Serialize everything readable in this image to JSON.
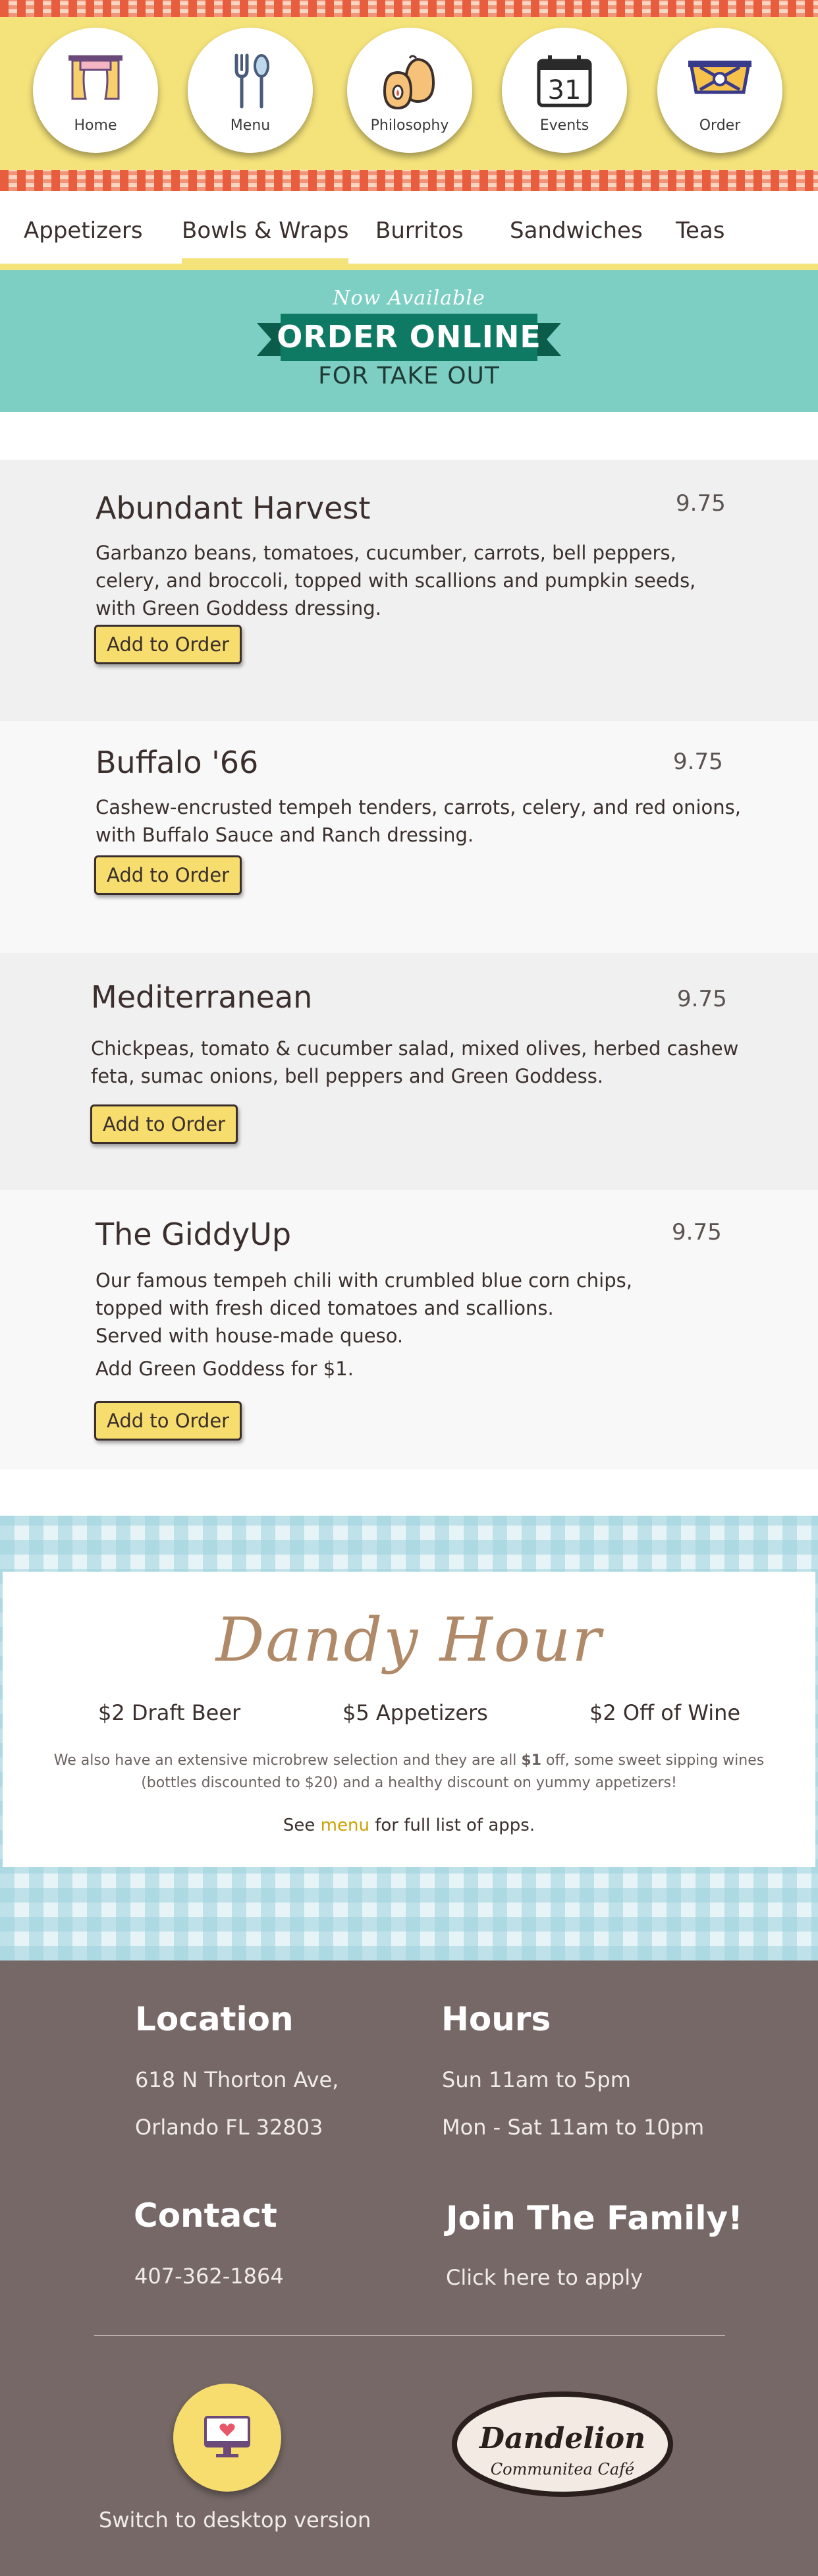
{
  "nav": {
    "items": [
      {
        "label": "Home",
        "icon": "curtains-icon"
      },
      {
        "label": "Menu",
        "icon": "utensils-icon"
      },
      {
        "label": "Philosophy",
        "icon": "fruit-icon"
      },
      {
        "label": "Events",
        "icon": "calendar-icon",
        "calendar_day": "31"
      },
      {
        "label": "Order",
        "icon": "takeout-box-icon"
      }
    ]
  },
  "tabs": {
    "items": [
      "Appetizers",
      "Bowls & Wraps",
      "Burritos",
      "Sandwiches",
      "Teas"
    ],
    "active": "Bowls & Wraps"
  },
  "banner": {
    "now_available": "Now Available",
    "order_online": "ORDER ONLINE",
    "for_take_out": "FOR TAKE OUT"
  },
  "menu": {
    "add_label": "Add to Order",
    "items": [
      {
        "name": "Abundant Harvest",
        "price": "9.75",
        "desc": [
          "Garbanzo beans, tomatoes, cucumber, carrots, bell peppers,",
          "celery, and broccoli, topped with scallions and pumpkin seeds,",
          "with Green Goddess dressing."
        ]
      },
      {
        "name": "Buffalo '66",
        "price": "9.75",
        "desc": [
          "Cashew-encrusted tempeh tenders, carrots, celery, and red onions,",
          "with Buffalo Sauce and Ranch dressing."
        ]
      },
      {
        "name": "Mediterranean",
        "price": "9.75",
        "desc": [
          "Chickpeas, tomato & cucumber salad, mixed olives, herbed cashew",
          "feta, sumac onions, bell peppers and Green Goddess."
        ]
      },
      {
        "name": "The GiddyUp",
        "price": "9.75",
        "desc": [
          "Our famous tempeh chili with crumbled blue corn chips,",
          "topped with fresh diced tomatoes and scallions.",
          "Served with house-made queso."
        ],
        "extra": "Add Green Goddess for $1."
      }
    ]
  },
  "dandy": {
    "title": "Dandy Hour",
    "deals": [
      "$2 Draft Beer",
      "$5 Appetizers",
      "$2 Off of Wine"
    ],
    "note_line1_pre": "We also have an extensive microbrew selection and they are all ",
    "note_line1_bold": "$1",
    "note_line1_post": " off, some sweet sipping wines",
    "note_line2": "(bottles discounted to $20) and a healthy discount on yummy appetizers!",
    "see_pre": "See ",
    "see_link": "menu",
    "see_post": " for full list of apps."
  },
  "footer": {
    "location_heading": "Location",
    "address1": "618 N Thorton Ave,",
    "address2": "Orlando FL 32803",
    "hours_heading": "Hours",
    "hours1": "Sun 11am to 5pm",
    "hours2": "Mon - Sat 11am to 10pm",
    "contact_heading": "Contact",
    "phone": "407-362-1864",
    "join_heading": "Join The Family!",
    "join_link": "Click here to apply",
    "desktop_link": "Switch to desktop version",
    "logo_name": "Dandelion",
    "logo_sub": "Communitea Café"
  },
  "colors": {
    "nav_yellow": "#f4e27a",
    "checker_red": "#e8563a",
    "banner_teal": "#7ecfc3",
    "ribbon_green": "#0f7a63",
    "button_yellow": "#f7dd6d",
    "footer_brown": "#756866",
    "dandy_brown": "#b08a68",
    "menu_link_gold": "#c9a400"
  }
}
